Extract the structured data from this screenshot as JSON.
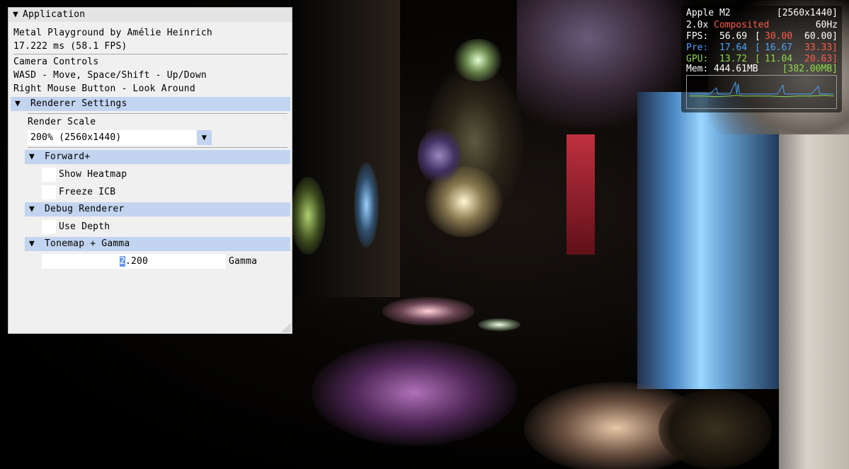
{
  "window": {
    "title": "Application",
    "collapse_arrow": "▼",
    "line1": "Metal Playground by Amélie Heinrich",
    "line2": "17.222 ms (58.1 FPS)",
    "camera_title": "Camera Controls",
    "camera_line1": "WASD - Move, Space/Shift - Up/Down",
    "camera_line2": "Right Mouse Button - Look Around"
  },
  "renderer": {
    "header": "Renderer Settings",
    "render_scale_label": "Render Scale",
    "render_scale_value": "200% (2560x1440)",
    "combo_arrow": "▼",
    "forward_header": "Forward+",
    "show_heatmap": "Show Heatmap",
    "freeze_icb": "Freeze ICB",
    "debug_header": "Debug Renderer",
    "use_depth": "Use Depth",
    "tonemap_header": "Tonemap + Gamma",
    "gamma_value_first": "2",
    "gamma_value_rest": ".200",
    "gamma_label": "Gamma"
  },
  "hud": {
    "device": "Apple M2",
    "resolution": "[2560x1440]",
    "scale": "2.0x",
    "mode": "Composited",
    "refresh": "60Hz",
    "fps_label": "FPS:",
    "fps_value": "56.69",
    "fps_open": "[",
    "fps_min": "30.00",
    "fps_max": "60.00]",
    "pre_label": "Pre:",
    "pre_value": "17.64",
    "pre_open": "[",
    "pre_min": "16.67",
    "pre_max": "33.33]",
    "gpu_label": "GPU:",
    "gpu_value": "13.72",
    "gpu_open": "[",
    "gpu_min": "11.04",
    "gpu_max": "20.63]",
    "mem_label": "Mem:",
    "mem_value": "444.61MB",
    "mem_budget": "[382.00MB]"
  },
  "colors": {
    "header_blue": "#c2d4ef",
    "hud_red": "#ff5a4a",
    "hud_blue": "#4aa3ff",
    "hud_green": "#8ed84a"
  }
}
